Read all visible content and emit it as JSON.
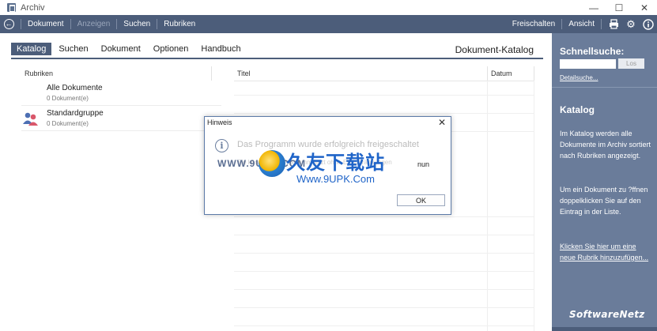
{
  "window": {
    "title": "Archiv",
    "controls": [
      "—",
      "☐",
      "✕"
    ]
  },
  "toolbar": {
    "items": [
      {
        "label": "Dokument",
        "disabled": false
      },
      {
        "label": "Anzeigen",
        "disabled": true
      },
      {
        "label": "Suchen",
        "disabled": false
      },
      {
        "label": "Rubriken",
        "disabled": false
      }
    ],
    "right": {
      "unlock": "Freischalten",
      "view": "Ansicht"
    },
    "icons": [
      "back-arrow-icon",
      "printer-icon",
      "gear-icon",
      "info-icon"
    ]
  },
  "tabs": [
    {
      "label": "Katalog",
      "active": true
    },
    {
      "label": "Suchen",
      "active": false
    },
    {
      "label": "Dokument",
      "active": false
    },
    {
      "label": "Optionen",
      "active": false
    },
    {
      "label": "Handbuch",
      "active": false
    }
  ],
  "catalog_title": "Dokument-Katalog",
  "columns": {
    "rubriken": "Rubriken",
    "titel": "Titel",
    "datum": "Datum"
  },
  "rubriken": [
    {
      "name": "Alle Dokumente",
      "count": "0 Dokument(e)",
      "icon": ""
    },
    {
      "name": "Standardgruppe",
      "count": "0 Dokument(e)",
      "icon": "group-icon"
    }
  ],
  "sidebar": {
    "quick_search_title": "Schnellsuche:",
    "search_button": "Los",
    "detail_search": "Detailsuche...",
    "catalog_heading": "Katalog",
    "catalog_text1": "Im Katalog werden alle Dokumente im Archiv sortiert nach Rubriken angezeigt.",
    "catalog_text2": "Um ein Dokument zu ?ffnen doppelklicken Sie auf den Eintrag in der Liste.",
    "add_rubric_link": "Klicken Sie hier um eine neue Rubrik hinzuzufügen...",
    "logo": "SoftwareNetz"
  },
  "dialog": {
    "title": "Hinweis",
    "message": "Das Programm wurde erfolgreich freigeschaltet",
    "message2": "Sie können das Programm jetzt ohne Einschränkungen",
    "message_end": "nun",
    "ok": "OK"
  },
  "watermark": {
    "site": "WWW.9UPK.COM",
    "brand": "久友下载站",
    "url": "Www.9UPK.Com"
  },
  "colors": {
    "toolbar": "#4c5d7a",
    "sidebar": "#6a7c9a",
    "accent": "#4c5d7a"
  }
}
